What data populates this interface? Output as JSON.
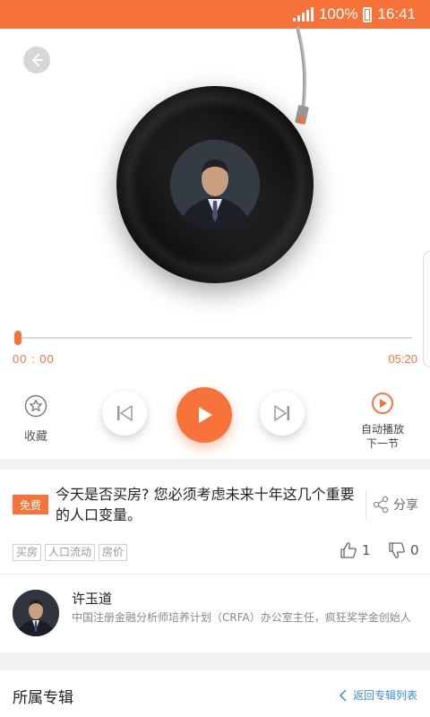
{
  "status_bar": {
    "battery_text": "100%",
    "time": "16:41"
  },
  "player": {
    "current_time": "00 : 00",
    "duration": "05:20",
    "progress_fraction": 0.0,
    "favorite_label": "收藏",
    "autoplay_label_line1": "自动播放",
    "autoplay_label_line2": "下一节"
  },
  "episode": {
    "badge": "免费",
    "title": "今天是否买房? 您必须考虑未来十年这几个重要的人口变量。",
    "share_label": "分享",
    "tags": [
      "买房",
      "人口流动",
      "房价"
    ],
    "like_count": "1",
    "dislike_count": "0"
  },
  "author": {
    "name": "许玉道",
    "description": "中国注册金融分析师培养计划（CRFA）办公室主任，疯狂奖学金创始人"
  },
  "album": {
    "label": "所属专辑",
    "back_link": "返回专辑列表"
  },
  "colors": {
    "accent": "#f7733a",
    "link": "#3a8be0"
  },
  "icons": [
    "back-arrow-icon",
    "star-icon",
    "previous-icon",
    "play-icon",
    "next-icon",
    "autoplay-icon",
    "share-icon",
    "thumbs-up-icon",
    "thumbs-down-icon",
    "chevron-left-icon"
  ]
}
